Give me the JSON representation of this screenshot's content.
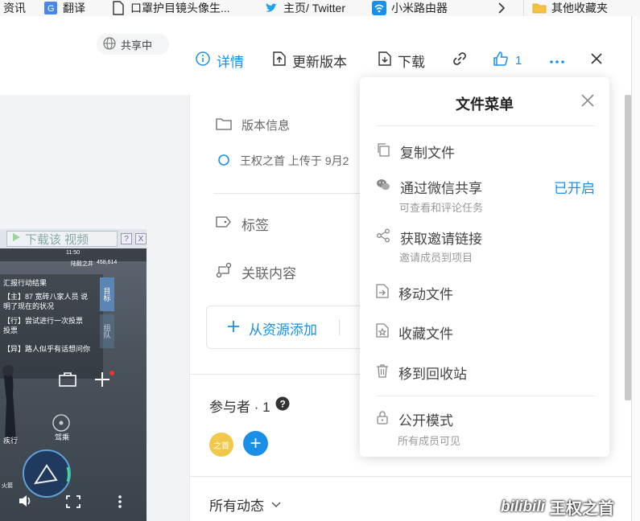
{
  "bookmarks": [
    {
      "label": "资讯"
    },
    {
      "label": "翻译"
    },
    {
      "label": "口罩护目镜头像生..."
    },
    {
      "label": "主页/ Twitter"
    },
    {
      "label": "小米路由器"
    },
    {
      "label": "其他收藏夹"
    }
  ],
  "toolbar": {
    "share": "共享中",
    "details": "详情",
    "update": "更新版本",
    "download": "下载",
    "likes": "1"
  },
  "panel": {
    "version_info": "版本信息",
    "uploader": "王权之首 上传于 9月2",
    "tags": "标签",
    "related": "关联内容",
    "add_from_resource": "从资源添加",
    "participants": "参与者 · 1",
    "participant_avatar": "之首",
    "activity": "所有动态"
  },
  "menu": {
    "title": "文件菜单",
    "items": [
      {
        "label": "复制文件"
      },
      {
        "label": "通过微信共享",
        "status": "已开启",
        "sub": "可查看和评论任务"
      },
      {
        "label": "获取邀请链接",
        "sub": "邀请成员到项目"
      },
      {
        "label": "移动文件"
      },
      {
        "label": "收藏文件"
      },
      {
        "label": "移到回收站"
      },
      {
        "label": "公开模式",
        "sub": "所有成员可见"
      }
    ]
  },
  "video": {
    "download_label": "下载该 视频",
    "help": "?",
    "close": "X",
    "status_time": "11:50",
    "location": "陆毅之井",
    "coords": "458,614",
    "chat": [
      "汇报行动结果",
      "【主】87 宽砖八家人员 说",
      "明了现在的状况",
      "【行】尝试进行一次投票",
      "投票",
      "【异】路人似乎有话想问你"
    ],
    "side_tab": "目标",
    "side_tab2": "组队",
    "left_label": "疾行",
    "mid_label": "驾乘",
    "low_label": "火箭"
  },
  "watermark": {
    "brand": "bilibili",
    "user": "王权之首"
  },
  "colors": {
    "accent": "#1a8fe8",
    "menu_bg": "#ffffff",
    "panel_bg": "#f2f3f5"
  }
}
